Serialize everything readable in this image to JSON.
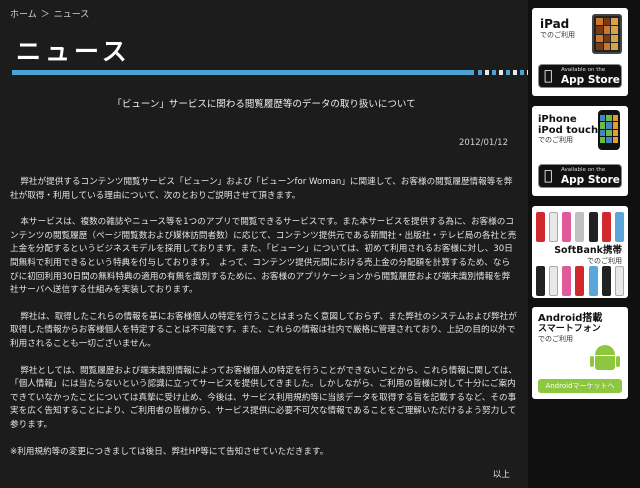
{
  "breadcrumb": {
    "home": "ホーム",
    "sep": "＞",
    "current": "ニュース"
  },
  "page_title": "ニュース",
  "article": {
    "title": "「ビューン」サービスに関わる閲覧履歴等のデータの取り扱いについて",
    "date": "2012/01/12",
    "paragraphs": [
      "弊社が提供するコンテンツ閲覧サービス「ビューン」および「ビューンfor Woman」に関連して、お客様の閲覧履歴情報等を弊社が取得・利用している理由について、次のとおりご説明させて頂きます。",
      "本サービスは、複数の雑誌やニュース等を1つのアプリで閲覧できるサービスです。また本サービスを提供する為に、お客様のコンテンツの閲覧履歴（ページ閲覧数および媒体訪問者数）に応じて、コンテンツ提供元である新聞社・出版社・テレビ局の各社と売上金を分配するというビジネスモデルを採用しております。また、「ビューン」については、初めて利用されるお客様に対し、30日間無料で利用できるという特典を付与しております。　よって、コンテンツ提供元間における売上金の分配額を計算するため、ならびに初回利用30日間の無料特典の適用の有無を識別するために、お客様のアプリケーションから閲覧履歴および端末識別情報を弊社サーバへ送信する仕組みを実装しております。",
      "弊社は、取得したこれらの情報を基にお客様個人の特定を行うことはまったく意図しておらず、また弊社のシステムおよび弊社が取得した情報からお客様個人を特定することは不可能です。また、これらの情報は社内で厳格に管理されており、上記の目的以外で利用されることも一切ございません。",
      "弊社としては、閲覧履歴および端末識別情報によってお客様個人の特定を行うことができないことから、これら情報に関しては、「個人情報」には当たらないという認識に立ってサービスを提供してきました。しかしながら、ご利用の皆様に対して十分にご案内できていなかったことについては真摯に受け止め、今後は、サービス利用規約等に当該データを取得する旨を記載するなど、その事実を広く告知することにより、ご利用者の皆様から、サービス提供に必要不可欠な情報であることをご理解いただけるよう努力して参ります。"
    ],
    "note": "※利用規約等の変更につきましては後日、弊社HP等にて告知させていただきます。",
    "closing": "以上"
  },
  "sidebar": {
    "ipad": {
      "title": "iPad",
      "subtitle": "でのご利用"
    },
    "iphone": {
      "title1": "iPhone",
      "title2": "iPod touch",
      "subtitle": "でのご利用"
    },
    "appstore": {
      "small": "Available on the",
      "big": "App Store"
    },
    "softbank": {
      "title": "SoftBank携帯",
      "subtitle": "でのご利用"
    },
    "android": {
      "title1": "Android搭載",
      "title2": "スマートフォン",
      "subtitle": "でのご利用",
      "button": "Androidマーケットへ"
    }
  },
  "colors": {
    "accent": "#4aa3d4",
    "android_green": "#8dc63f"
  }
}
